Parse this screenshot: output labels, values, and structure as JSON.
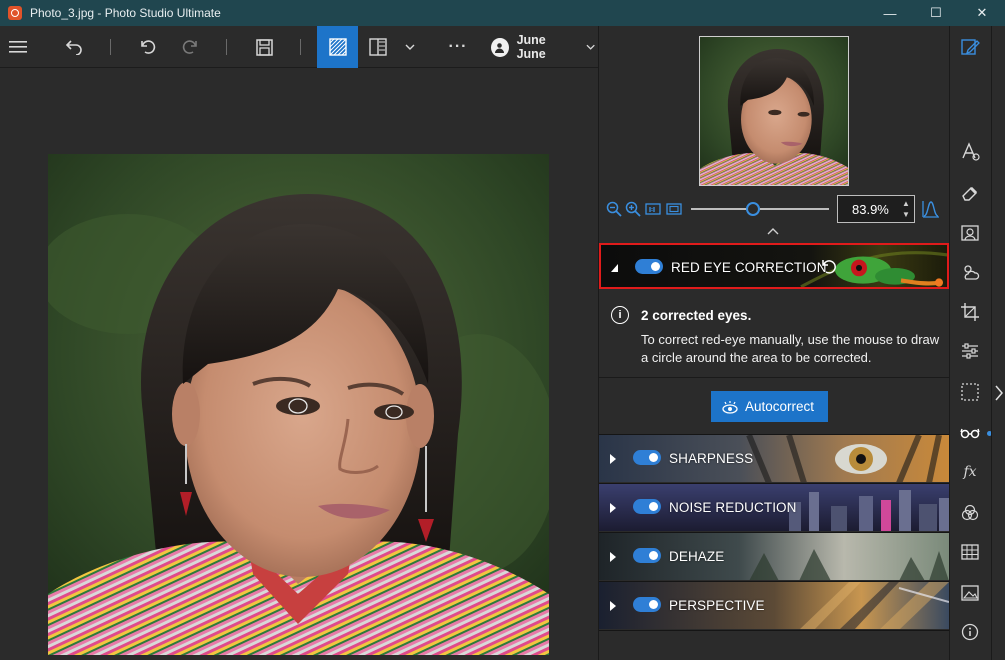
{
  "window": {
    "title": "Photo_3.jpg - Photo Studio Ultimate",
    "minimize_glyph": "—",
    "maximize_glyph": "☐",
    "close_glyph": "✕"
  },
  "toolbar": {
    "more_glyph": "···",
    "user_name": "June June"
  },
  "zoom": {
    "value": "83.9%",
    "level_fraction": 0.45
  },
  "panel": {
    "red_eye": {
      "label": "RED EYE CORRECTION",
      "enabled": true,
      "info_title": "2 corrected eyes.",
      "info_text": "To correct red-eye manually, use the mouse to draw a circle around the area to be corrected.",
      "autocorrect_label": "Autocorrect"
    },
    "sections": [
      {
        "label": "SHARPNESS",
        "enabled": true
      },
      {
        "label": "NOISE REDUCTION",
        "enabled": true
      },
      {
        "label": "DEHAZE",
        "enabled": true
      },
      {
        "label": "PERSPECTIVE",
        "enabled": true
      }
    ]
  },
  "sidebar": {
    "icons": [
      "edit-icon",
      "text-shapes-icon",
      "eraser-icon",
      "portrait-icon",
      "weather-icon",
      "crop-icon",
      "sliders-icon",
      "selection-icon",
      "glasses-icon",
      "fx-icon",
      "color-circles-icon",
      "grid-icon",
      "image-icon",
      "info-icon"
    ],
    "fx_label": "fx"
  },
  "colors": {
    "accent": "#1d74c9",
    "titlebar": "#20464f",
    "highlight_border": "#e01b1b"
  }
}
